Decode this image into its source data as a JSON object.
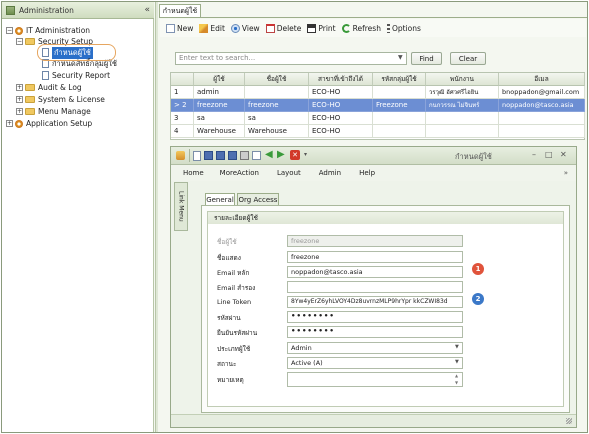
{
  "left_panel": {
    "title": "Administration",
    "collapse_glyph": "«",
    "tree": [
      {
        "label": "IT Administration",
        "icon": "gear-icon",
        "expander": "−"
      },
      {
        "label": "Security Setup",
        "icon": "folder-icon",
        "expander": "−"
      },
      {
        "label": "กำหนดผู้ใช้",
        "icon": "document-icon",
        "selected": true
      },
      {
        "label": "กำหนดสิทธิ์กลุ่มผู้ใช้",
        "icon": "document-icon"
      },
      {
        "label": "Security Report",
        "icon": "document-icon"
      },
      {
        "label": "Audit & Log",
        "icon": "folder-icon",
        "expander": "+"
      },
      {
        "label": "System & License",
        "icon": "folder-icon",
        "expander": "+"
      },
      {
        "label": "Menu Manage",
        "icon": "folder-icon",
        "expander": "+"
      },
      {
        "label": "Application Setup",
        "icon": "gear-icon",
        "expander": "+"
      }
    ]
  },
  "main": {
    "tab_label": "กำหนดผู้ใช้",
    "toolbar": {
      "new": "New",
      "edit": "Edit",
      "view": "View",
      "delete": "Delete",
      "print": "Print",
      "refresh": "Refresh",
      "options": "Options"
    },
    "search": {
      "placeholder": "Enter text to search...",
      "find": "Find",
      "clear": "Clear"
    },
    "grid": {
      "columns": [
        "ผู้ใช้",
        "ชื่อผู้ใช้",
        "สาขาที่เข้าถึงได้",
        "รหัสกลุ่มผู้ใช้",
        "พนักงาน",
        "อีเมล"
      ],
      "rows": [
        {
          "num": "1",
          "cells": [
            "admin",
            "",
            "ECO-HO",
            "",
            "วรวุฒิ อัศวศรีไอยิน",
            "bnoppadon@gmail.com"
          ]
        },
        {
          "num": "> 2",
          "cells": [
            "freezone",
            "freezone",
            "ECO-HO",
            "Freezone",
            "กนกวรรณ ไม่จินทร์",
            "noppadon@tasco.asia"
          ],
          "selected": true
        },
        {
          "num": "3",
          "cells": [
            "sa",
            "sa",
            "ECO-HO",
            "",
            "",
            ""
          ]
        },
        {
          "num": "4",
          "cells": [
            "Warehouse",
            "Warehouse",
            "ECO-HO",
            "",
            "",
            ""
          ]
        }
      ]
    }
  },
  "child_window": {
    "title": "กำหนดผู้ใช้",
    "menu": [
      "Home",
      "MoreAction",
      "Layout",
      "Admin",
      "Help"
    ],
    "side_tab": "Link Menu",
    "tabs": [
      "General",
      "Org Access"
    ],
    "group_title": "รายละเอียดผู้ใช้",
    "fields": [
      {
        "label": "ชื่อผู้ใช้",
        "value": "freezone",
        "disabled": true
      },
      {
        "label": "ชื่อแสดง",
        "value": "freezone"
      },
      {
        "label": "Email หลัก",
        "value": "noppadon@tasco.asia"
      },
      {
        "label": "Email สำรอง",
        "value": ""
      },
      {
        "label": "Line Token",
        "value": "8Yw4yErZ6yhLVOY4Dz8uvrnzMLP9hrYpr kkCZWI83d"
      },
      {
        "label": "รหัสผ่าน",
        "value": "••••••••"
      },
      {
        "label": "ยืนยันรหัสผ่าน",
        "value": "••••••••"
      },
      {
        "label": "ประเภทผู้ใช้",
        "value": "Admin"
      },
      {
        "label": "สถานะ",
        "value": "Active (A)"
      },
      {
        "label": "หมายเหตุ",
        "value": ""
      }
    ],
    "badges": [
      "1",
      "2"
    ]
  },
  "colors": {
    "selection": "#2a6fc9",
    "grid_selection": "#6c8ed3",
    "badge_red": "#e0533b",
    "badge_blue": "#3b78c8",
    "annotation_oval": "#e6a660"
  }
}
